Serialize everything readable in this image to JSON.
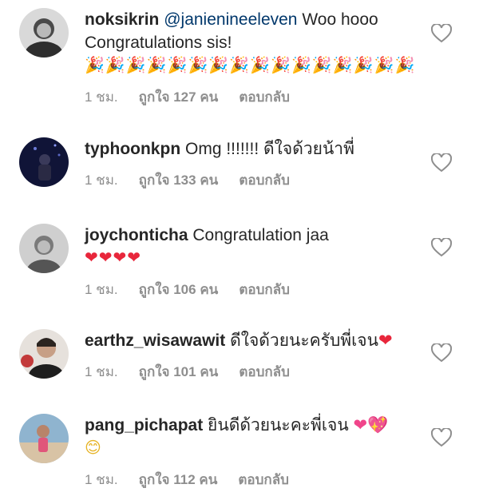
{
  "comments": [
    {
      "username": "noksikrin",
      "mention": "@janienineeleven",
      "text": " Woo hooo Congratulations sis!",
      "emoji": "🎉🎉🎉🎉🎉🎉🎉🎉🎉🎉🎉🎉🎉🎉🎉🎉",
      "time": "1 ชม.",
      "likes": "ถูกใจ 127 คน",
      "reply": "ตอบกลับ",
      "avatar_color": "#4a4a4a"
    },
    {
      "username": "typhoonkpn",
      "text": " Omg !!!!!!! ดีใจด้วยน้าพี่",
      "time": "1 ชม.",
      "likes": "ถูกใจ 133 คน",
      "reply": "ตอบกลับ",
      "avatar_color": "#1b1f4a"
    },
    {
      "username": "joychonticha",
      "text": " Congratulation jaa",
      "emoji": "❤❤❤❤",
      "time": "1 ชม.",
      "likes": "ถูกใจ 106 คน",
      "reply": "ตอบกลับ",
      "avatar_color": "#777777"
    },
    {
      "username": "earthz_wisawawit",
      "text": " ดีใจด้วยนะครับพี่เจน",
      "emoji": "❤",
      "time": "1 ชม.",
      "likes": "ถูกใจ 101 คน",
      "reply": "ตอบกลับ",
      "avatar_color": "#6b5a4e"
    },
    {
      "username": "pang_pichapat",
      "text": " ยินดีด้วยนะคะพี่เจน ",
      "emoji": "❤💖",
      "emoji2": "😊",
      "time": "1 ชม.",
      "likes": "ถูกใจ 112 คน",
      "reply": "ตอบกลับ",
      "avatar_color": "#c9a58a"
    }
  ],
  "icons": {
    "like": "heart-outline-icon"
  },
  "colors": {
    "username": "#262626",
    "mention": "#00376b",
    "meta": "#8e8e8e",
    "heart_emoji": "#e8263b"
  }
}
